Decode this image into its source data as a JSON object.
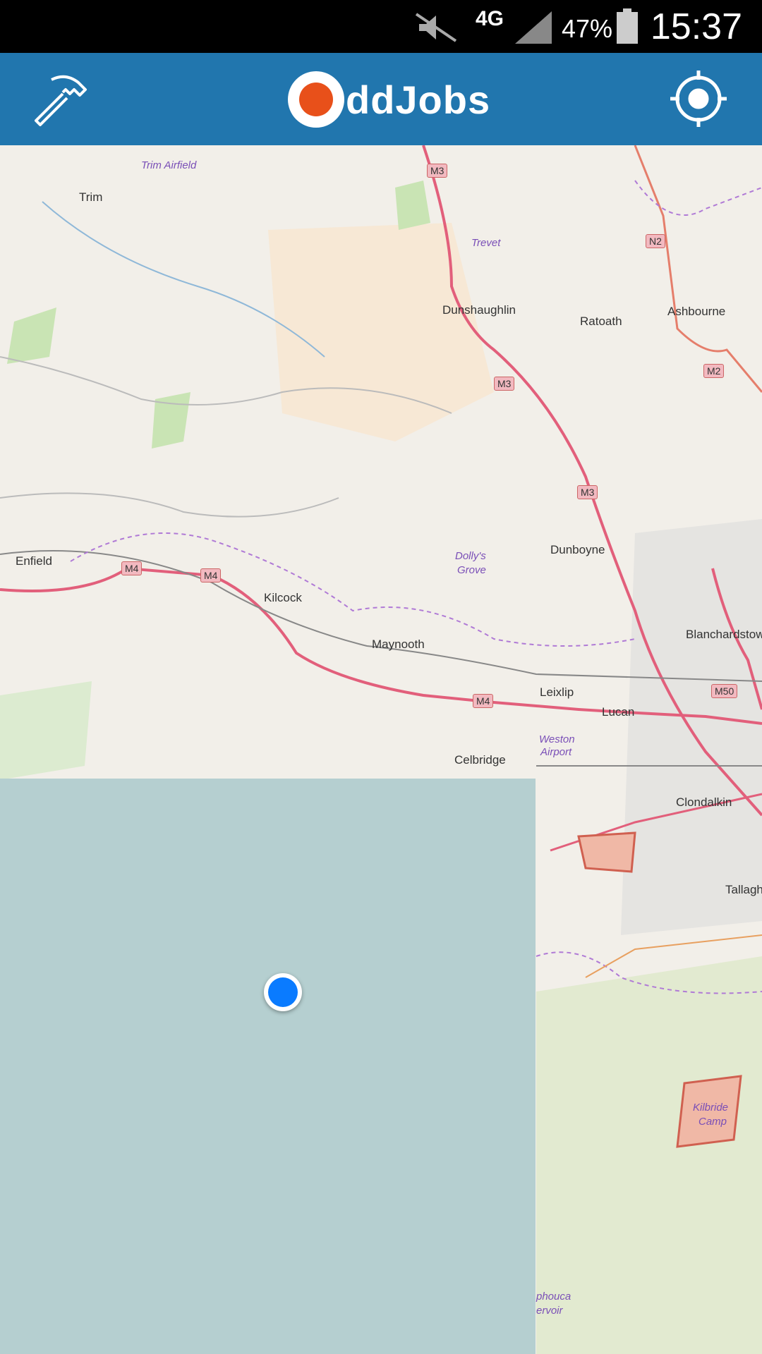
{
  "status_bar": {
    "network": "4G",
    "battery": "47%",
    "time": "15:37"
  },
  "app_bar": {
    "title": "ddJobs",
    "left_icon": "hammer-icon",
    "right_icon": "locate-icon"
  },
  "map": {
    "places": [
      "Trim",
      "Trim Airfield",
      "Trevet",
      "Dunshaughlin",
      "Ratoath",
      "Ashbourne",
      "Enfield",
      "Kilcock",
      "Maynooth",
      "Dolly's",
      "Grove",
      "Dunboyne",
      "Blanchardstow",
      "Leixlip",
      "Lucan",
      "Weston",
      "Airport",
      "Celbridge",
      "Clondalkin",
      "Tallagh",
      "Kilbride",
      "Camp",
      "phouca",
      "ervoir"
    ],
    "road_shields": [
      "M3",
      "N2",
      "M3",
      "M2",
      "M3",
      "M4",
      "M4",
      "M4",
      "M50"
    ]
  },
  "colors": {
    "app_bar": "#2176ae",
    "logo_accent": "#e8501a",
    "location_dot": "#0a7bff",
    "water_tile": "#b5cfd0"
  }
}
